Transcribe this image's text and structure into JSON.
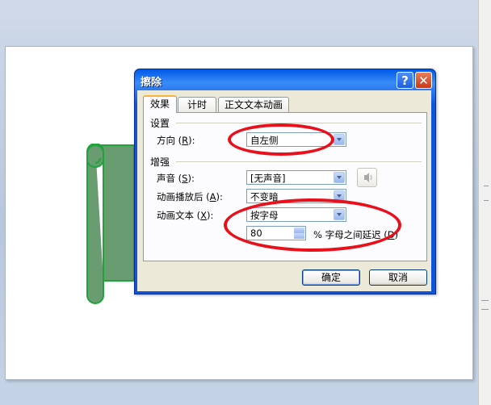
{
  "dialog": {
    "title": "擦除",
    "help_label": "?",
    "close_label": "✕",
    "tabs": [
      {
        "label": "效果",
        "active": true
      },
      {
        "label": "计时",
        "active": false
      },
      {
        "label": "正文文本动画",
        "active": false
      }
    ],
    "settings": {
      "section_title": "设置",
      "direction_label": "方向",
      "direction_key": "R",
      "direction_value": "自左侧"
    },
    "enhance": {
      "section_title": "增强",
      "sound_label": "声音",
      "sound_key": "S",
      "sound_value": "[无声音]",
      "after_anim_label": "动画播放后",
      "after_anim_key": "A",
      "after_anim_value": "不变暗",
      "anim_text_label": "动画文本",
      "anim_text_key": "X",
      "anim_text_value": "按字母",
      "delay_value": "80",
      "delay_suffix": "% 字母之间延迟",
      "delay_key": "D"
    },
    "ok_label": "确定",
    "cancel_label": "取消"
  },
  "colors": {
    "annotation": "#e8101a",
    "shape_fill": "#6a9c72",
    "shape_stroke": "#1fa33a"
  },
  "icons": [
    "speaker-icon",
    "help-icon",
    "close-icon",
    "chevron-down-icon"
  ]
}
